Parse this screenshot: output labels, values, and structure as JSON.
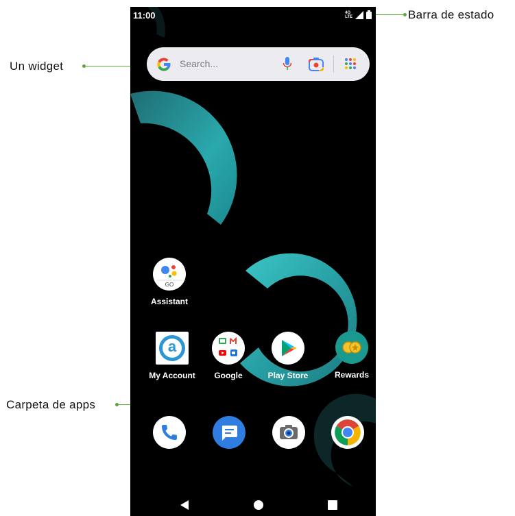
{
  "callouts": {
    "status_bar": "Barra de estado",
    "widget": "Un widget",
    "app_folder": "Carpeta de apps"
  },
  "status_bar": {
    "time": "11:00",
    "network": [
      "4G",
      "LTE"
    ],
    "icons": [
      "signal-icon",
      "battery-icon"
    ]
  },
  "search_widget": {
    "placeholder": "Search...",
    "logo": "G",
    "icons": [
      "google-logo-icon",
      "microphone-icon",
      "lens-camera-icon",
      "app-grid-icon"
    ]
  },
  "apps": [
    {
      "label": "Assistant",
      "icon": "assistant-icon",
      "sub": "GO"
    },
    {
      "label": "My Account",
      "icon": "my-account-icon",
      "glyph": "a"
    },
    {
      "label": "Google",
      "icon": "google-folder-icon"
    },
    {
      "label": "Play Store",
      "icon": "play-store-icon"
    },
    {
      "label": "Rewards",
      "icon": "rewards-icon"
    }
  ],
  "dock": [
    {
      "icon": "phone-icon",
      "color": "#2f7de0"
    },
    {
      "icon": "messages-icon",
      "color": "#2f7de0"
    },
    {
      "icon": "camera-icon",
      "color": "#6a6a6a"
    },
    {
      "icon": "chrome-icon",
      "color": "#db4437"
    }
  ],
  "navigation": [
    "back-icon",
    "home-icon",
    "recents-icon"
  ],
  "colors": {
    "wallpaper": "#000000",
    "accent_teal": "#2ab0b3",
    "callout_line": "#5aa83c"
  }
}
